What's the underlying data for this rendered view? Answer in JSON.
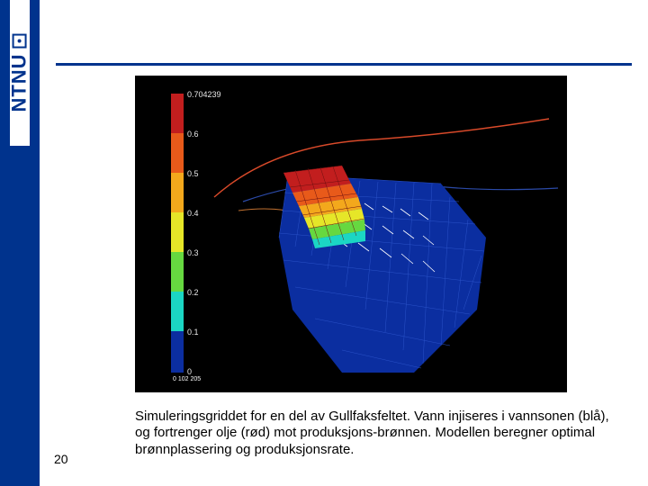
{
  "brand": {
    "name": "NTNU"
  },
  "page_number": "20",
  "caption": "Simuleringsgriddet for en del av Gullfaksfeltet. Vann injiseres i vannsonen (blå), og fortrenger olje (rød) mot produksjons-brønnen. Modellen beregner optimal brønnplassering og produksjonsrate.",
  "colorbar": {
    "labels": [
      "0.704239",
      "0.6",
      "0.5",
      "0.4",
      "0.3",
      "0.2",
      "0.1",
      "0"
    ],
    "scale_text": "0   102   205"
  }
}
